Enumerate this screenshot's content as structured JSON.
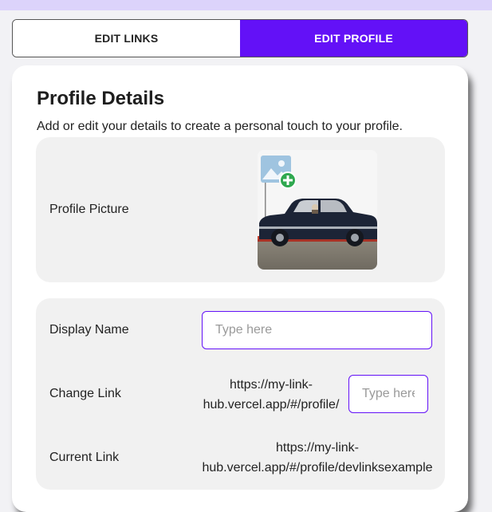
{
  "tabs": {
    "edit_links": "EDIT LINKS",
    "edit_profile": "EDIT PROFILE",
    "active": "edit_profile"
  },
  "profile": {
    "title": "Profile Details",
    "subtitle": "Add or edit your details to create a personal touch to your profile.",
    "picture_label": "Profile Picture",
    "picture_icon": "add-image-icon"
  },
  "fields": {
    "display_name_label": "Display Name",
    "display_name_placeholder": "Type here",
    "display_name_value": "",
    "change_link_label": "Change Link",
    "change_link_prefix": "https://my-link-hub.vercel.app/#/profile/",
    "change_link_placeholder": "Type here",
    "change_link_value": "",
    "current_link_label": "Current Link",
    "current_link_value": "https://my-link-hub.vercel.app/#/profile/devlinksexample"
  },
  "colors": {
    "accent": "#6311f7",
    "top_strip": "#dcd3fb",
    "panel_bg": "#f1f1f1",
    "add_badge": "#2fa84f"
  }
}
